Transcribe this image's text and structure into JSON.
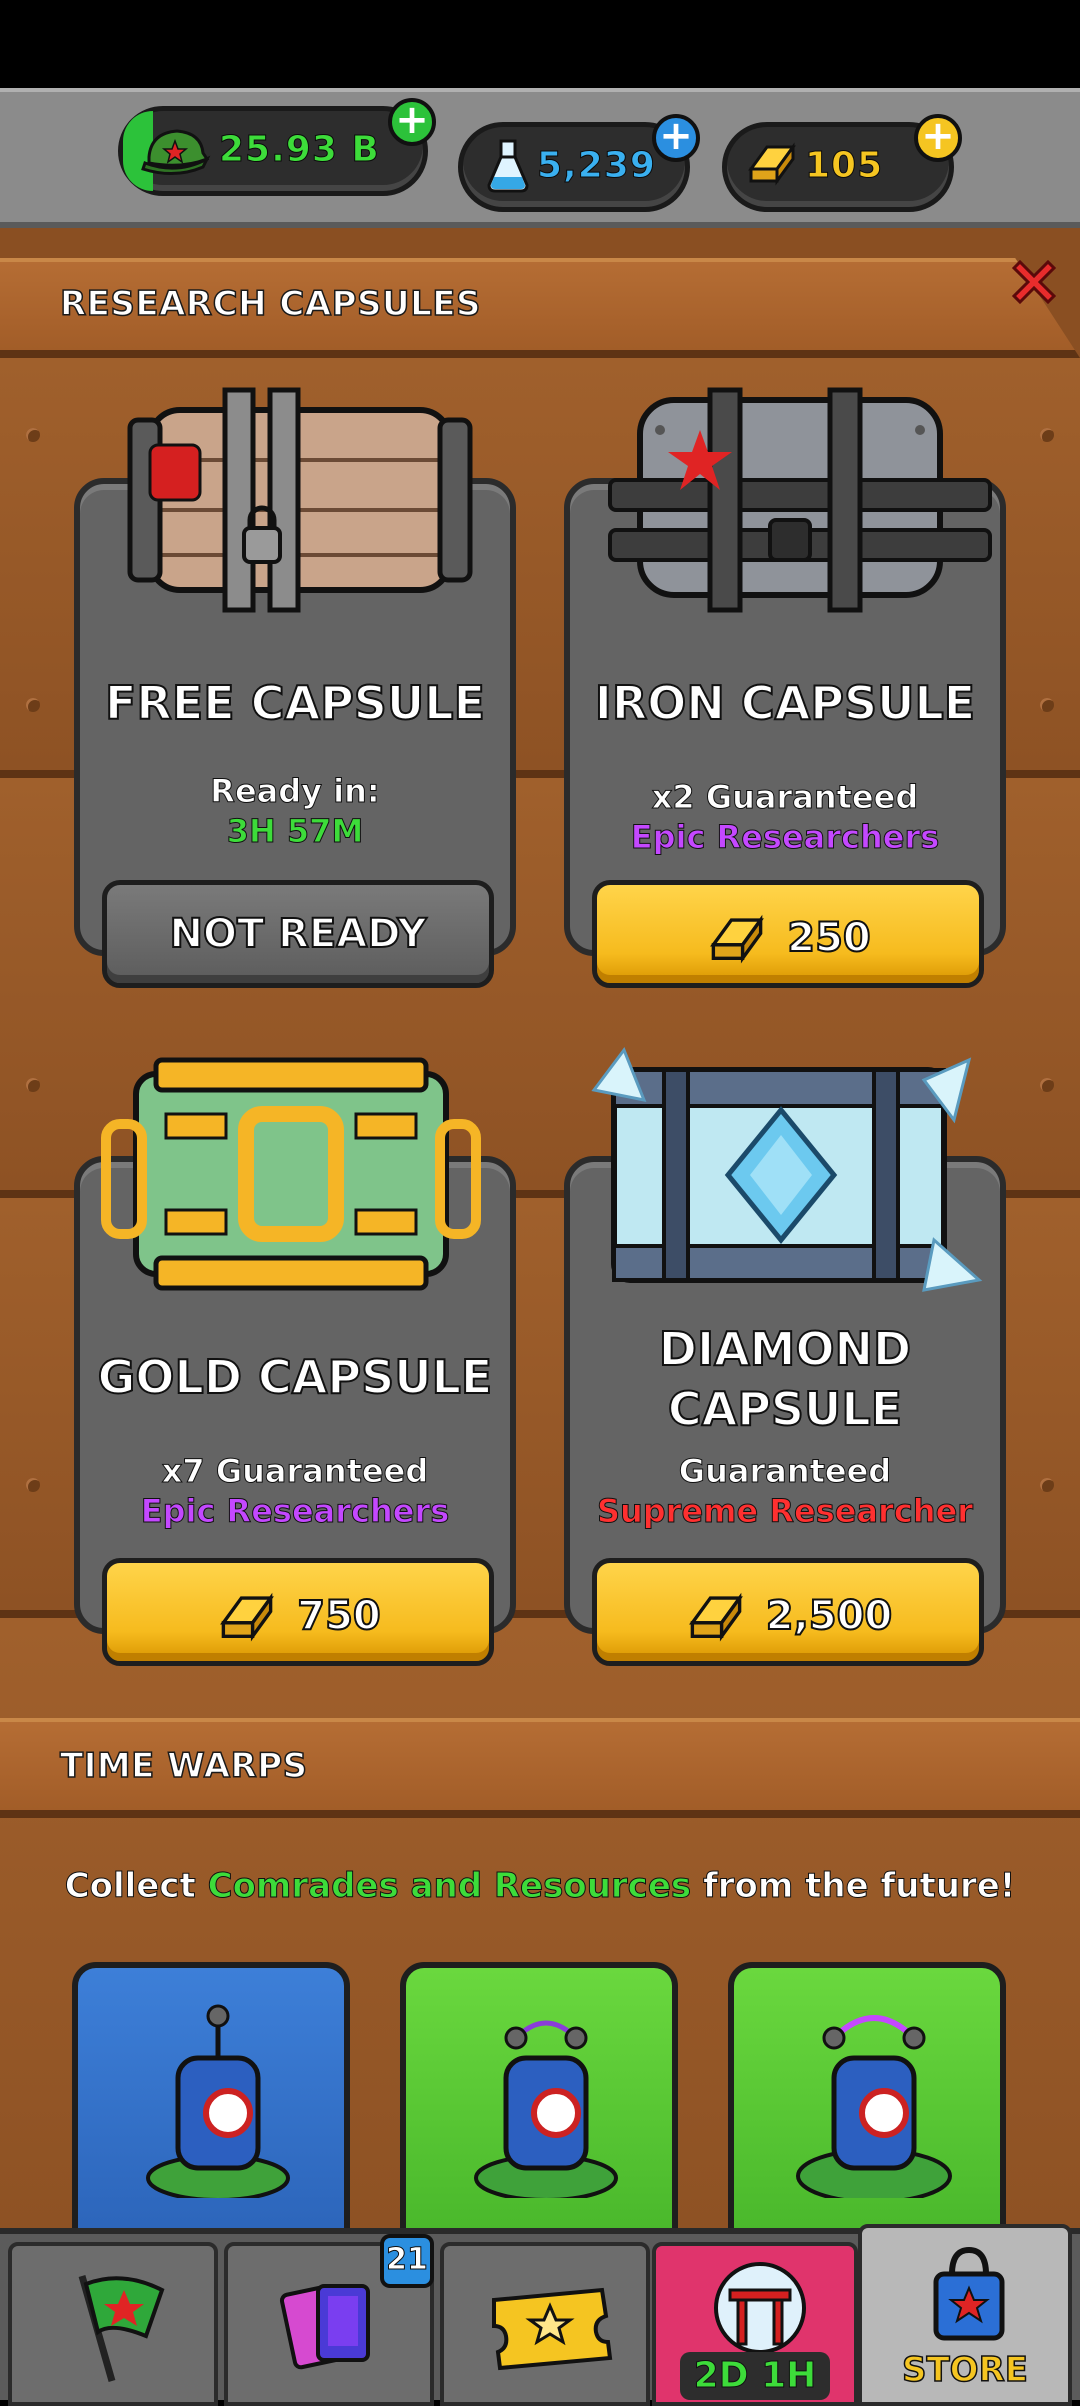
{
  "currency": {
    "cash": {
      "value": "25.93 B",
      "color": "#3ddc3a"
    },
    "science": {
      "value": "5,239",
      "color": "#3ab0f0"
    },
    "gold": {
      "value": "105",
      "color": "#f5c521"
    }
  },
  "research": {
    "section_title": "RESEARCH CAPSULES",
    "cards": [
      {
        "title": "FREE CAPSULE",
        "line1": "Ready in:",
        "line2": "3H 57M",
        "line2_color": "#3ddc3a",
        "button": "NOT READY"
      },
      {
        "title": "IRON CAPSULE",
        "line1": "x2 Guaranteed",
        "line2": "Epic Researchers",
        "line2_color": "#c448ff",
        "price": "250"
      },
      {
        "title": "GOLD CAPSULE",
        "line1": "x7 Guaranteed",
        "line2": "Epic Researchers",
        "line2_color": "#c448ff",
        "price": "750"
      },
      {
        "title_line1": "DIAMOND",
        "title_line2": "CAPSULE",
        "line1": "Guaranteed",
        "line2": "Supreme Researcher",
        "line2_color": "#ff3030",
        "price": "2,500"
      }
    ]
  },
  "time_warps": {
    "section_title": "TIME WARPS",
    "subtitle_pre": "Collect ",
    "subtitle_highlight": "Comrades and Resources",
    "subtitle_post": " from the future!"
  },
  "bottom_nav": {
    "cards_badge": "21",
    "event_timer": "2D 1H",
    "store_label": "STORE"
  }
}
